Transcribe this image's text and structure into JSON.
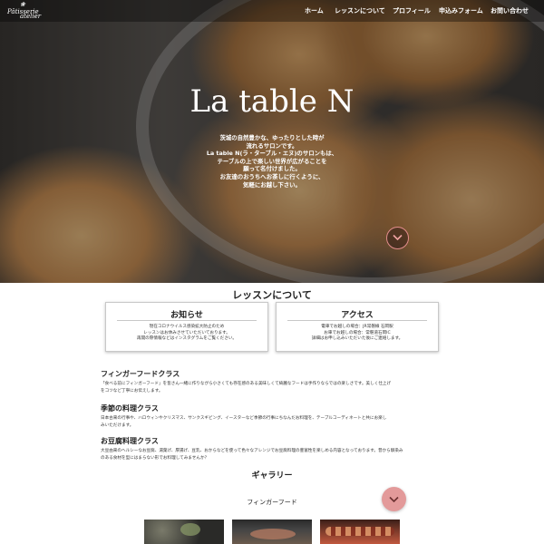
{
  "nav": {
    "logo": {
      "line1": "Pâtisserie",
      "line2": "atelier"
    },
    "items": [
      "ホーム",
      "レッスンについて",
      "プロフィール",
      "申込みフォーム",
      "お問い合わせ"
    ]
  },
  "hero": {
    "title": "La table N",
    "lines": [
      "茨城の自然豊かな、ゆったりとした時が",
      "流れるサロンです。",
      "La table N(ラ・ターブル・エヌ)のサロンもは、",
      "テーブルの上で楽しい世界が広がることを",
      "願って名付けました。",
      "お友達のおうちへお茶しに行くように、",
      "気軽にお越し下さい。"
    ]
  },
  "lesson_section": {
    "title": "レッスンについて"
  },
  "cards": [
    {
      "title": "お知らせ",
      "lines": [
        "現在コロナウイルス感染拡大防止のため",
        "レッスンはお休みさせていただいております。",
        "再開の際情報などはインスタグラムをご覧ください。"
      ]
    },
    {
      "title": "アクセス",
      "lines": [
        "電車でお越しの場合：JR常磐線 石岡駅",
        "お車でお越しの場合：常磐道石岡IC",
        "詳細はお申し込みいただいた後にご連絡します。"
      ]
    }
  ],
  "classes": [
    {
      "title": "フィンガーフードクラス",
      "lines": [
        "「食べる前にフィンガーフード」を皆さん一緒に作りながら小さくても存在感のある美味しくて綺麗なフードは手作りならではの楽しさです。美しく仕上げ",
        "をコツなど丁寧にお伝えします。"
      ]
    },
    {
      "title": "季節の料理クラス",
      "lines": [
        "日本古来の行事や、ハロウィンやクリスマス、サンクスギビング、イースターなど季節の行事にちなんだお料理を、テーブルコーディネートと共にお楽し",
        "みいただけます。"
      ]
    },
    {
      "title": "お豆腐料理クラス",
      "lines": [
        "大豆由来のヘルシーなお豆腐、湯葉げ、厚揚げ、豆乳、おからなどを使って色々なアレンジでお豆腐料理の豊富性を楽しめる内容となっております。昔から馴染み",
        "のある食材を型にはまらない形でお料理してみませんか？"
      ]
    }
  ],
  "gallery": {
    "title": "ギャラリー",
    "subtitle": "フィンガーフード"
  },
  "colors": {
    "accent": "#e39a9a",
    "nav_text": "#ffffff"
  },
  "icons": {
    "scroll": "chevron-down-icon",
    "pink": "chevron-down-icon"
  }
}
